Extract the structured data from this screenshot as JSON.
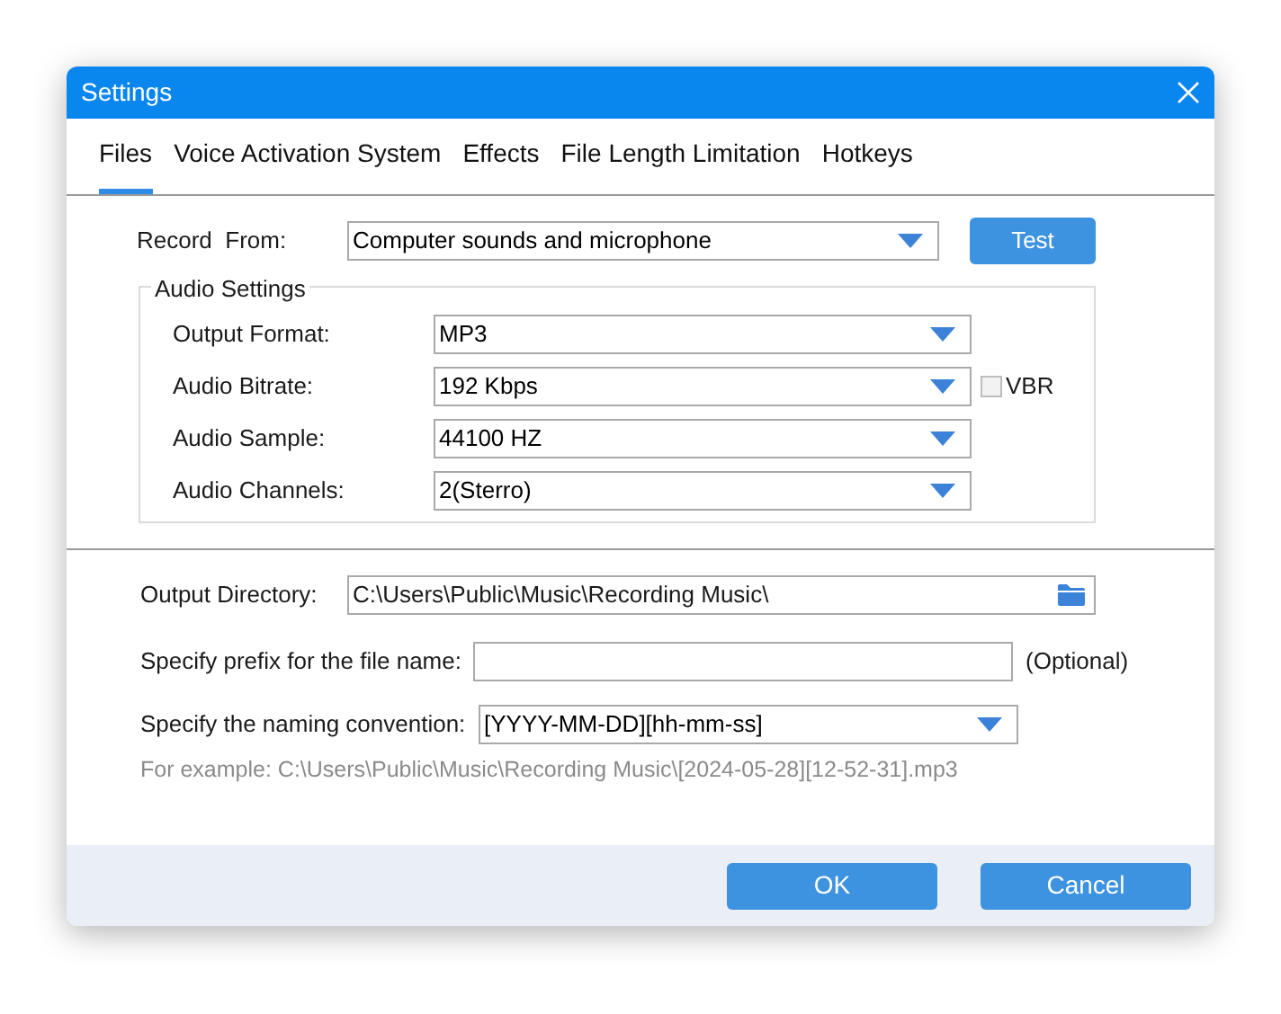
{
  "window": {
    "title": "Settings"
  },
  "tabs": [
    {
      "label": "Files",
      "selected": true
    },
    {
      "label": "Voice Activation System",
      "selected": false
    },
    {
      "label": "Effects",
      "selected": false
    },
    {
      "label": "File Length Limitation",
      "selected": false
    },
    {
      "label": "Hotkeys",
      "selected": false
    }
  ],
  "record_from": {
    "label": "Record  From:",
    "value": "Computer sounds and microphone",
    "button": "Test"
  },
  "audio_settings": {
    "title": "Audio Settings",
    "rows": [
      {
        "label": "Output Format:",
        "value": "MP3"
      },
      {
        "label": "Audio Bitrate:",
        "value": "192 Kbps",
        "checkbox": {
          "label": "VBR",
          "checked": false
        }
      },
      {
        "label": "Audio Sample:",
        "value": "44100 HZ"
      },
      {
        "label": "Audio Channels:",
        "value": "2(Sterro)"
      }
    ]
  },
  "output_directory": {
    "label": "Output Directory:",
    "value": "C:\\Users\\Public\\Music\\Recording Music\\"
  },
  "prefix": {
    "label": "Specify prefix for the file name:",
    "note": "(Optional)"
  },
  "naming": {
    "label": "Specify the naming convention:",
    "value": "[YYYY-MM-DD][hh-mm-ss]"
  },
  "example": "For example: C:\\Users\\Public\\Music\\Recording Music\\[2024-05-28][12-52-31].mp3",
  "buttons": [
    "OK",
    "Cancel"
  ]
}
